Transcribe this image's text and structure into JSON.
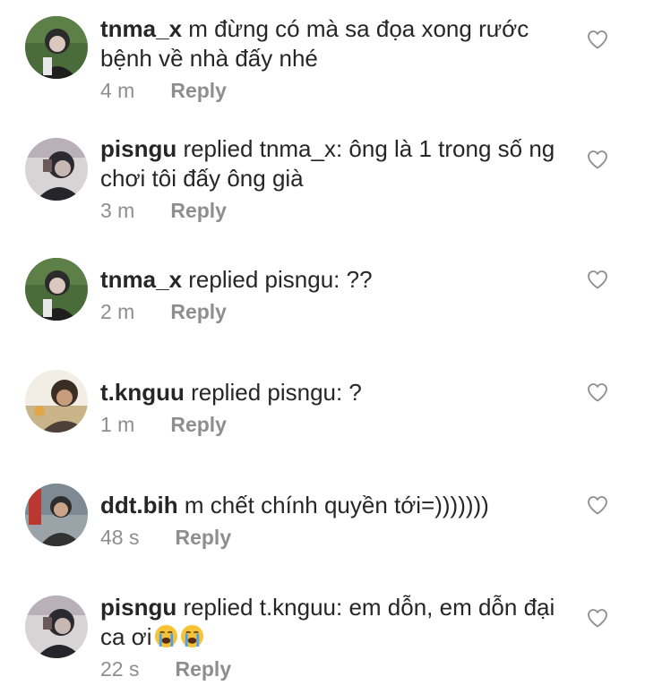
{
  "comments": [
    {
      "username": "tnma_x",
      "body": " m đừng có mà sa đọa xong rước bệnh về nhà đấy nhé",
      "time": "4 m",
      "reply_label": "Reply",
      "avatar_icon": "avatar-tnma_x",
      "like_icon": "heart-outline-icon"
    },
    {
      "username": "pisngu",
      "body": " replied tnma_x: ông là 1 trong số ng chơi tôi đấy ông già",
      "time": "3 m",
      "reply_label": "Reply",
      "avatar_icon": "avatar-pisngu",
      "like_icon": "heart-outline-icon"
    },
    {
      "username": "tnma_x",
      "body": " replied pisngu: ??",
      "time": "2 m",
      "reply_label": "Reply",
      "avatar_icon": "avatar-tnma_x",
      "like_icon": "heart-outline-icon"
    },
    {
      "username": "t.knguu",
      "body": " replied pisngu: ?",
      "time": "1 m",
      "reply_label": "Reply",
      "avatar_icon": "avatar-t.knguu",
      "like_icon": "heart-outline-icon"
    },
    {
      "username": "ddt.bih",
      "body": " m chết chính quyền tới=)))))))",
      "time": "48 s",
      "reply_label": "Reply",
      "avatar_icon": "avatar-ddt.bih",
      "like_icon": "heart-outline-icon"
    },
    {
      "username": "pisngu",
      "body": " replied t.knguu: em dỗn, em dỗn đại ca ơi",
      "emoji": [
        "loudly-crying-face-emoji",
        "loudly-crying-face-emoji"
      ],
      "time": "22 s",
      "reply_label": "Reply",
      "avatar_icon": "avatar-pisngu",
      "like_icon": "heart-outline-icon"
    }
  ],
  "colors": {
    "text": "#262626",
    "meta": "#8e8e8e",
    "heart_stroke": "#8e8e8e",
    "background": "#ffffff"
  }
}
